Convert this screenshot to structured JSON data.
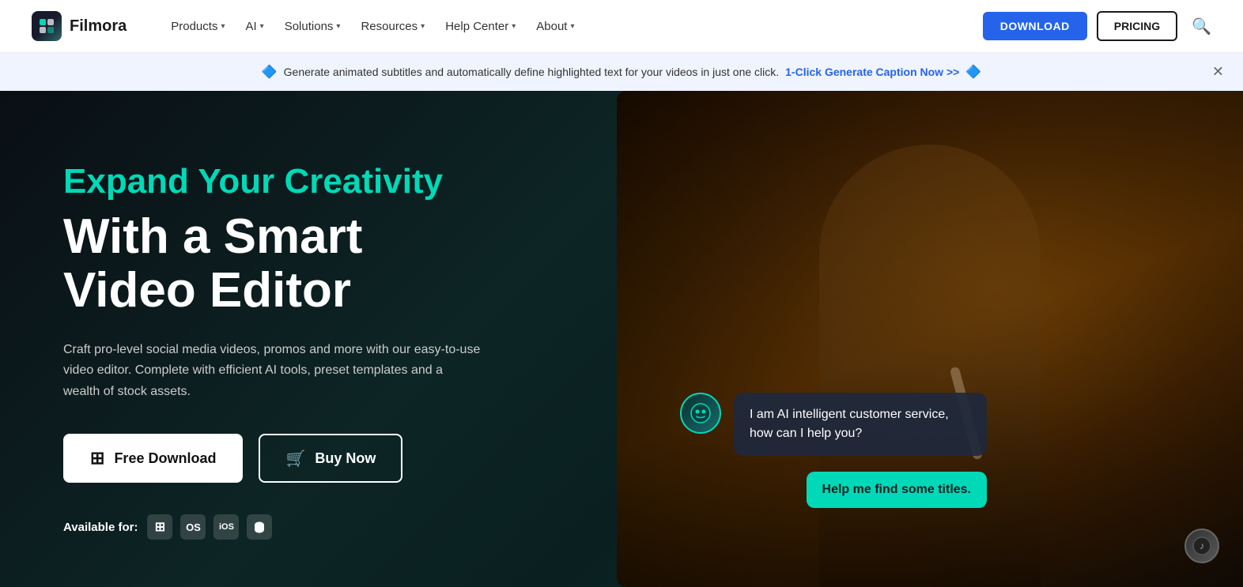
{
  "nav": {
    "logo_icon": "🎬",
    "logo_text": "Filmora",
    "links": [
      {
        "label": "Products",
        "has_chevron": true
      },
      {
        "label": "AI",
        "has_chevron": true
      },
      {
        "label": "Solutions",
        "has_chevron": true
      },
      {
        "label": "Resources",
        "has_chevron": true
      },
      {
        "label": "Help Center",
        "has_chevron": true
      },
      {
        "label": "About",
        "has_chevron": true
      }
    ],
    "btn_download": "DOWNLOAD",
    "btn_pricing": "PRICING"
  },
  "banner": {
    "text_before": "Generate animated subtitles and automatically define highlighted text for your videos in just one click.",
    "link_text": "1-Click Generate Caption Now >>",
    "icon": "🔷"
  },
  "hero": {
    "tagline": "Expand Your Creativity",
    "title_line1": "With a Smart",
    "title_line2": "Video Editor",
    "description": "Craft pro-level social media videos, promos and more with our easy-to-use video editor. Complete with efficient AI tools, preset templates and a wealth of stock assets.",
    "btn_free_download": "Free Download",
    "btn_buy_now": "Buy Now",
    "available_for_label": "Available for:",
    "platforms": [
      {
        "name": "windows",
        "icon": "⊞"
      },
      {
        "name": "macos",
        "icon": ""
      },
      {
        "name": "ios",
        "icon": ""
      },
      {
        "name": "android",
        "icon": ""
      }
    ],
    "chat_ai_message": "I am AI intelligent customer service, how can I help you?",
    "chat_user_message": "Help me find some titles.",
    "bot_icon": "🤖",
    "user_icon": "🎵"
  }
}
